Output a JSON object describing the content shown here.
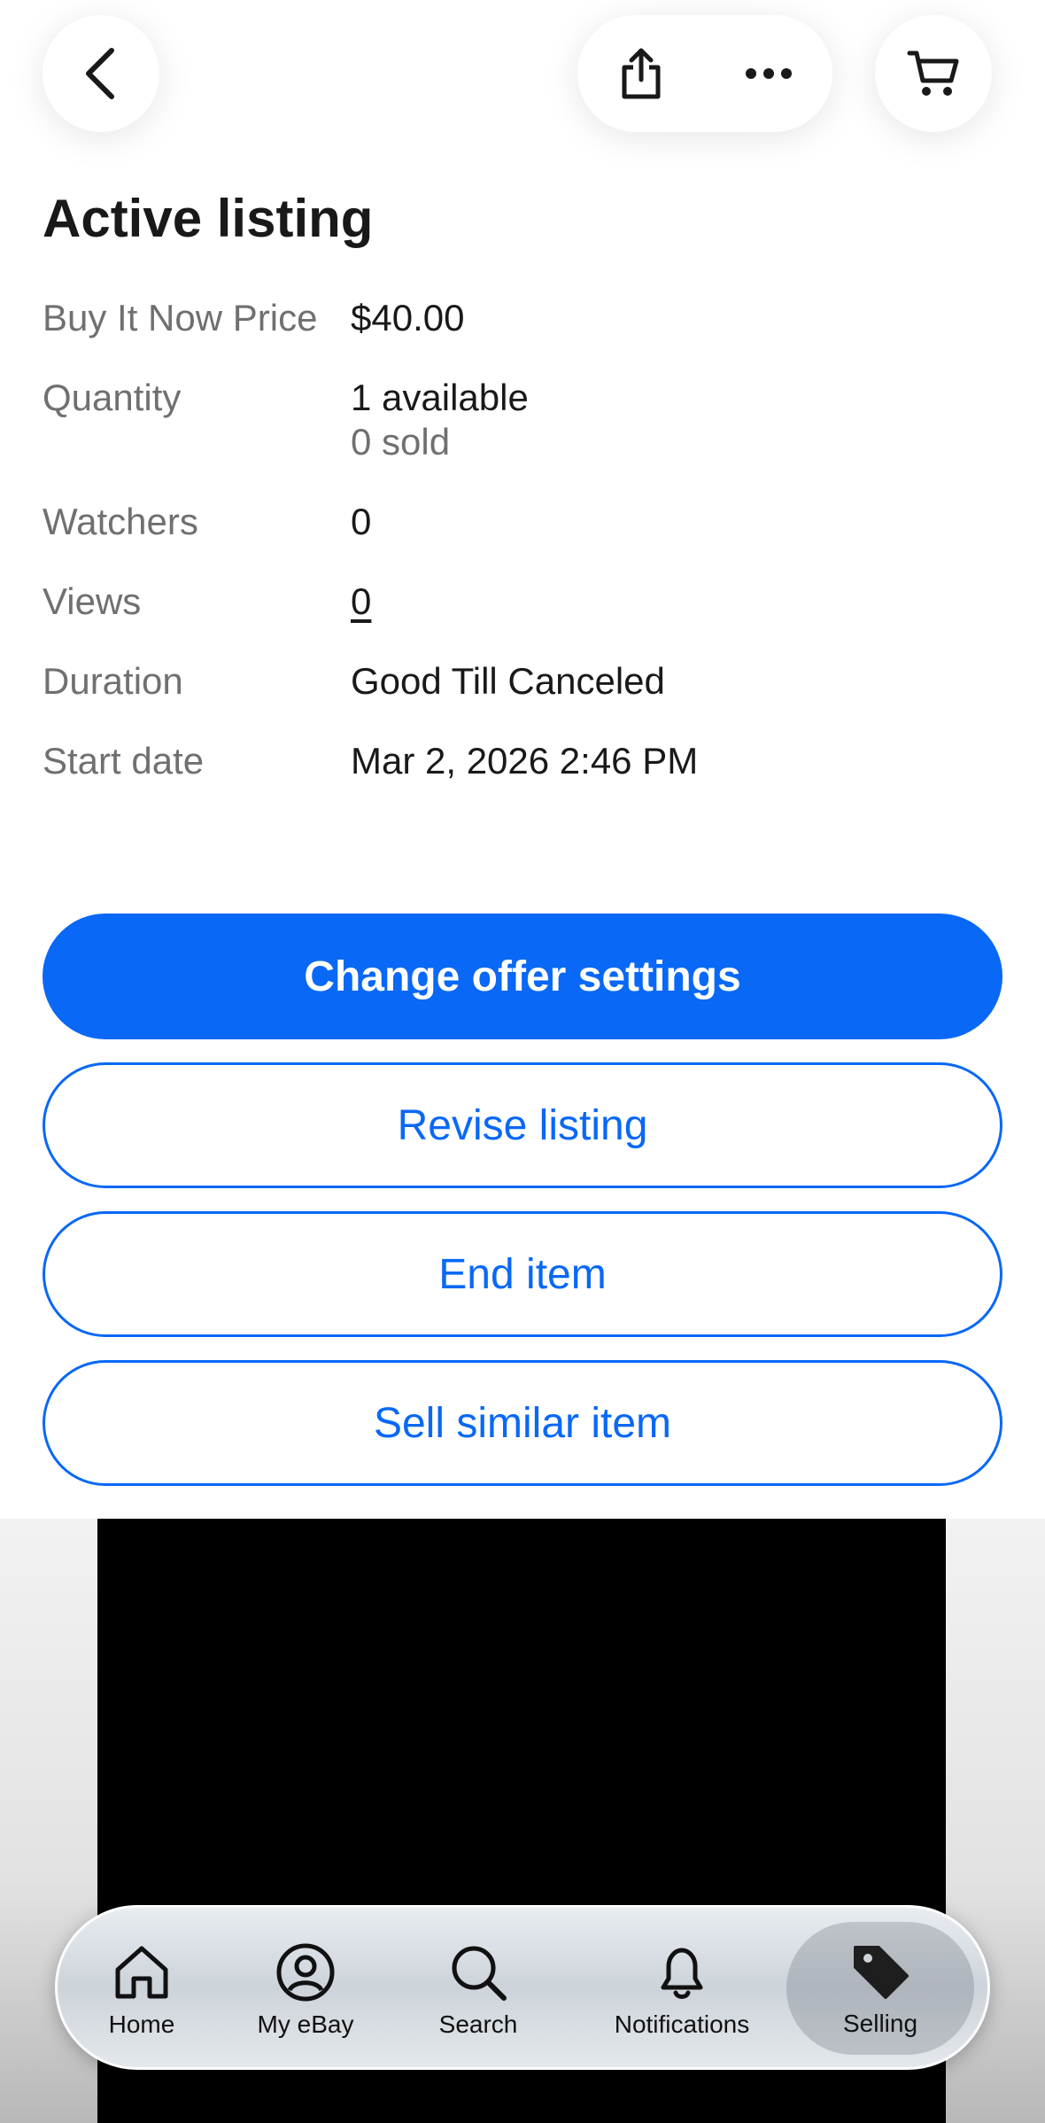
{
  "header": {
    "back": "back",
    "share": "share",
    "more": "more",
    "cart": "cart"
  },
  "section_title": "Active listing",
  "details": [
    {
      "label": "Buy It Now Price",
      "value": "$40.00"
    },
    {
      "label": "Quantity",
      "value": "1 available",
      "sub": "0 sold"
    },
    {
      "label": "Watchers",
      "value": "0"
    },
    {
      "label": "Views",
      "value": "0"
    },
    {
      "label": "Duration",
      "value": "Good Till Canceled"
    },
    {
      "label": "Start date",
      "value": "Mar 2, 2026 2:46 PM"
    }
  ],
  "actions": {
    "change_offer": "Change offer settings",
    "revise": "Revise listing",
    "end": "End item",
    "sell_similar": "Sell similar item"
  },
  "nav": {
    "items": [
      {
        "label": "Home",
        "icon": "home-icon"
      },
      {
        "label": "My eBay",
        "icon": "user-circle-icon"
      },
      {
        "label": "Search",
        "icon": "search-icon"
      },
      {
        "label": "Notifications",
        "icon": "bell-icon"
      },
      {
        "label": "Selling",
        "icon": "tag-icon"
      }
    ],
    "selected": "Selling"
  },
  "colors": {
    "accent": "#0968f6",
    "text": "#191919",
    "muted": "#707070"
  }
}
